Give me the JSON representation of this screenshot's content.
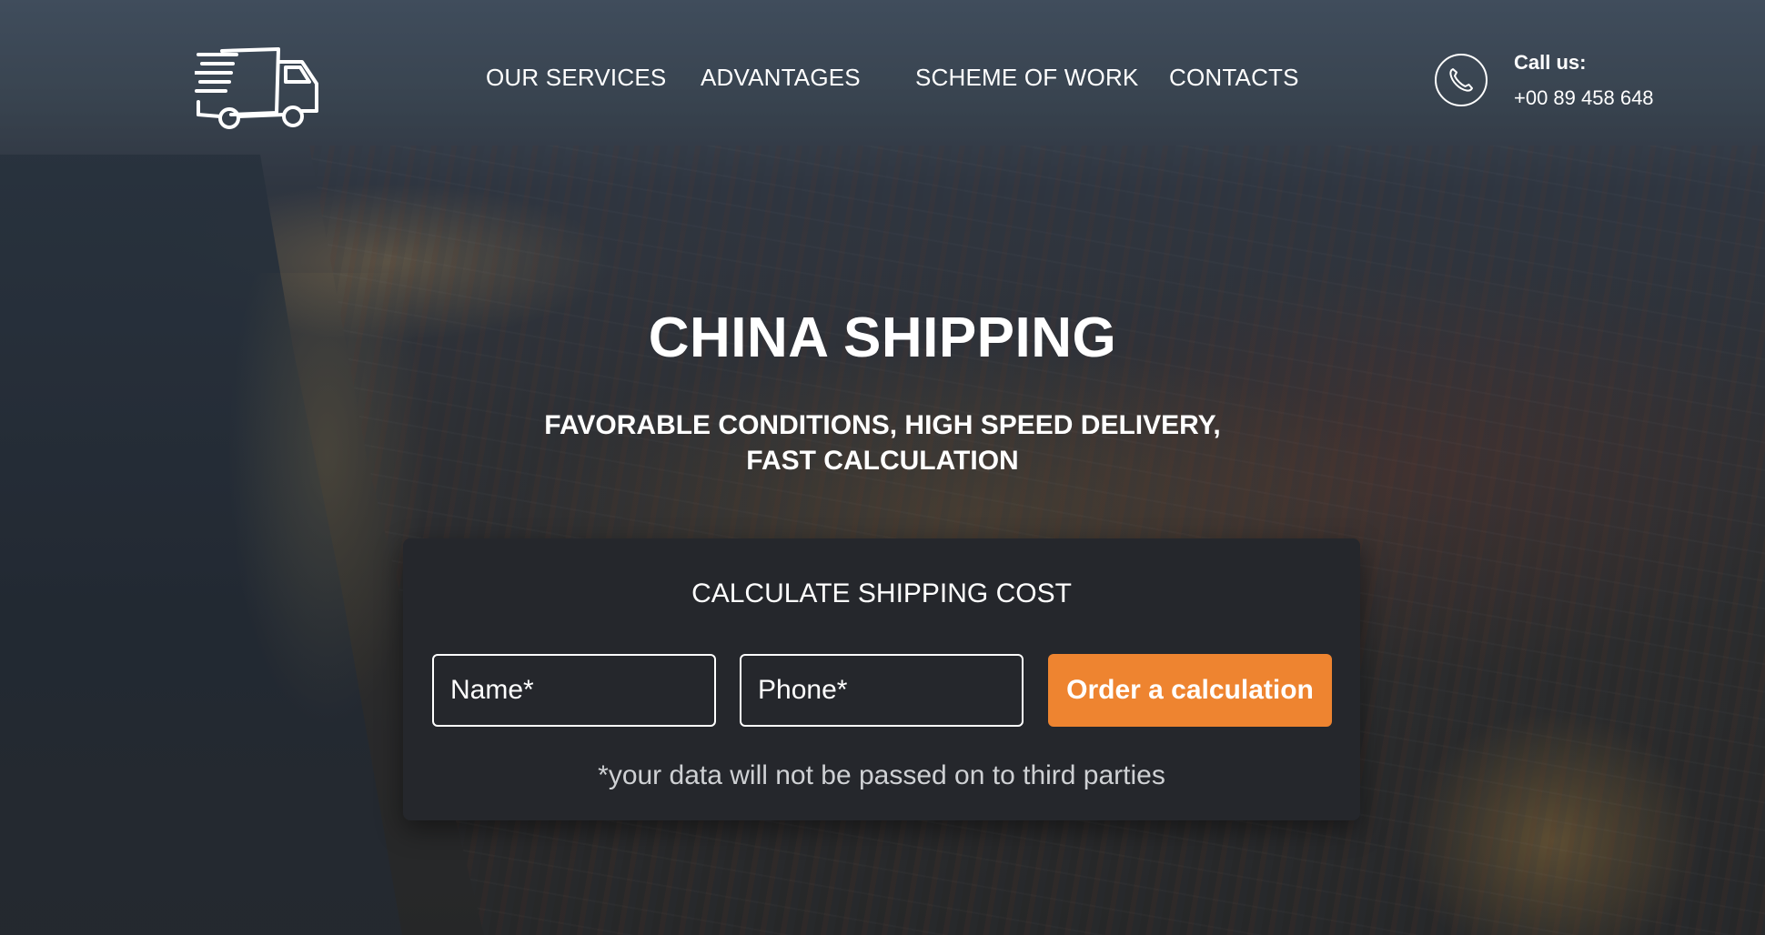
{
  "nav": {
    "items": [
      {
        "label": "OUR SERVICES"
      },
      {
        "label": "ADVANTAGES"
      },
      {
        "label": "SCHEME OF WORK"
      },
      {
        "label": "CONTACTS"
      }
    ]
  },
  "contact": {
    "call_label": "Call us:",
    "phone": "+00 89 458 648"
  },
  "hero": {
    "title": "CHINA SHIPPING",
    "subtitle_line1": "FAVORABLE CONDITIONS, HIGH SPEED DELIVERY,",
    "subtitle_line2": "FAST CALCULATION"
  },
  "form": {
    "title": "CALCULATE SHIPPING COST",
    "name_placeholder": "Name*",
    "phone_placeholder": "Phone*",
    "button_label": "Order a calculation",
    "note": "*your data will not be passed on to third parties"
  },
  "colors": {
    "accent": "#ee8430",
    "card": "#25272c"
  },
  "icons": {
    "logo": "delivery-truck-icon",
    "phone": "phone-icon"
  }
}
